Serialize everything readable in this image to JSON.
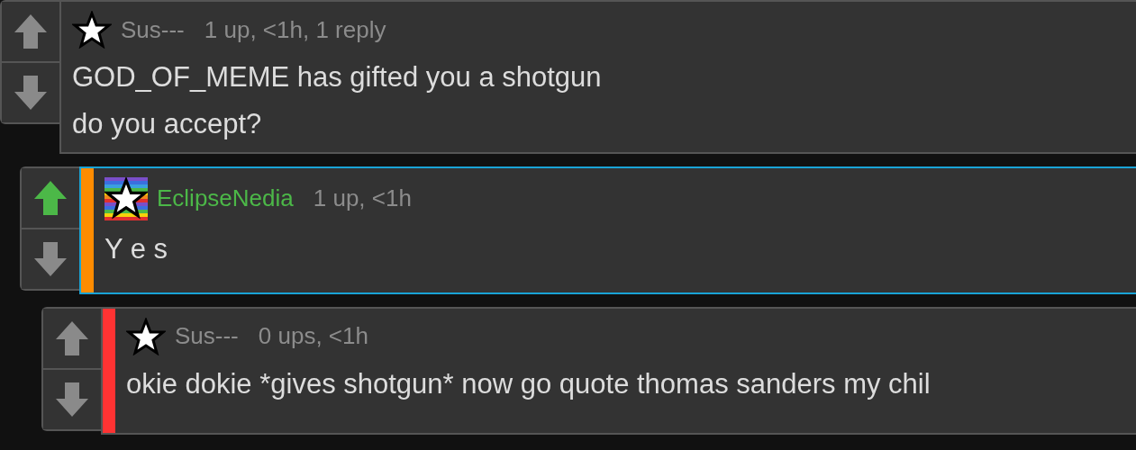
{
  "comments": [
    {
      "kind": "plain",
      "username": "Sus---",
      "meta": "1 up, <1h, 1 reply",
      "body": [
        "GOD_OF_MEME has gifted you a shotgun",
        "do you accept?"
      ],
      "upvoted": false,
      "highlighted": false,
      "children": [
        {
          "kind": "rainbow",
          "username": "EclipseNedia",
          "meta": "1 up, <1h",
          "body": [
            "Y e s"
          ],
          "upvoted": true,
          "highlighted": true,
          "color": "#ff8c00",
          "children": [
            {
              "kind": "plain",
              "username": "Sus---",
              "meta": "0 ups, <1h",
              "body": [
                "okie dokie *gives shotgun* now go quote thomas sanders my chil"
              ],
              "upvoted": false,
              "highlighted": false,
              "color": "#ff3333"
            }
          ]
        }
      ]
    }
  ]
}
